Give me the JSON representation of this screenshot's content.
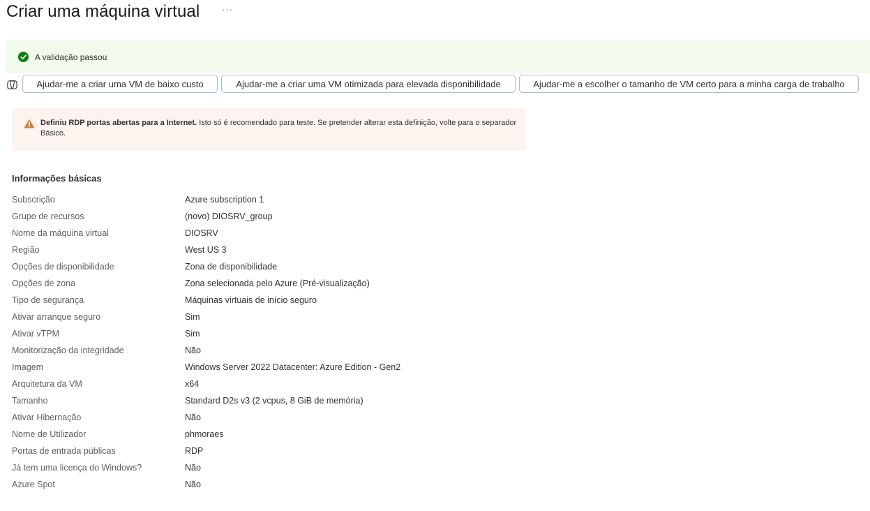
{
  "header": {
    "title": "Criar uma máquina virtual",
    "more_icon": "ellipsis-icon",
    "more_label": "···"
  },
  "validation": {
    "icon": "check-circle-icon",
    "text": "A validação passou",
    "color": "#107c10"
  },
  "copilot": {
    "icon": "copilot-icon",
    "suggestions": [
      "Ajudar-me a criar uma VM de baixo custo",
      "Ajudar-me a criar uma VM otimizada para elevada disponibilidade",
      "Ajudar-me a escolher o tamanho de VM certo para a minha carga de trabalho"
    ]
  },
  "warning": {
    "icon": "warning-icon",
    "color": "#d67f3c",
    "bold_text": "Definiu RDP portas abertas para a Internet.",
    "text": " Isto só é recomendado para teste.  Se pretender alterar esta definição, volte para o separador Básico."
  },
  "basics": {
    "title": "Informações básicas",
    "rows": [
      {
        "label": "Subscrição",
        "value": "Azure subscription 1"
      },
      {
        "label": "Grupo de recursos",
        "value": "(novo) DIOSRV_group"
      },
      {
        "label": "Nome da máquina virtual",
        "value": "DIOSRV"
      },
      {
        "label": "Região",
        "value": "West US 3"
      },
      {
        "label": "Opções de disponibilidade",
        "value": "Zona de disponibilidade"
      },
      {
        "label": "Opções de zona",
        "value": "Zona selecionada pelo Azure (Pré-visualização)"
      },
      {
        "label": "Tipo de segurança",
        "value": "Máquinas virtuais de início seguro"
      },
      {
        "label": "Ativar arranque seguro",
        "value": "Sim"
      },
      {
        "label": "Ativar vTPM",
        "value": "Sim"
      },
      {
        "label": "Monitorização da integridade",
        "value": "Não"
      },
      {
        "label": "Imagem",
        "value": "Windows Server 2022 Datacenter: Azure Edition - Gen2"
      },
      {
        "label": "Arquitetura da VM",
        "value": "x64"
      },
      {
        "label": "Tamanho",
        "value": "Standard D2s v3 (2 vcpus, 8 GiB de memória)"
      },
      {
        "label": "Ativar Hibernação",
        "value": "Não"
      },
      {
        "label": "Nome de Utilizador",
        "value": "phmoraes"
      },
      {
        "label": "Portas de entrada públicas",
        "value": "RDP"
      },
      {
        "label": "Já tem uma licença do Windows?",
        "value": "Não"
      },
      {
        "label": "Azure Spot",
        "value": "Não"
      }
    ]
  }
}
